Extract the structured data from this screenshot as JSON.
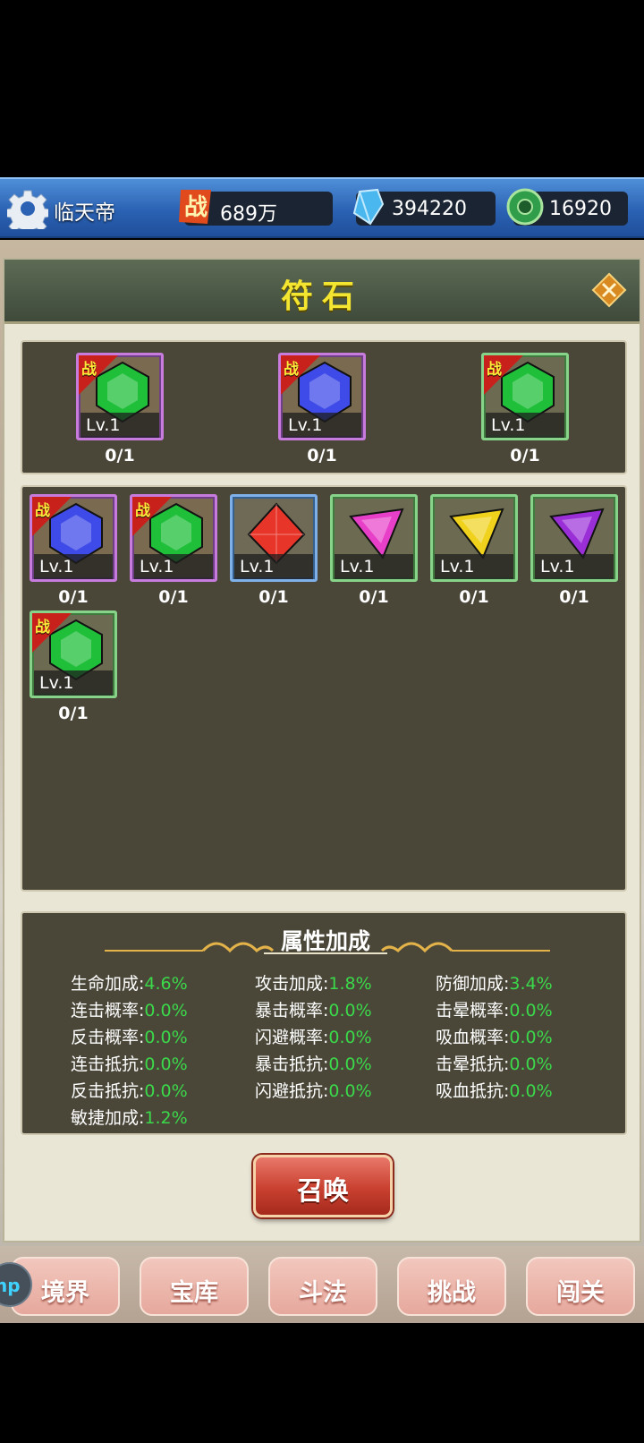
{
  "header": {
    "player_name": "临天帝",
    "power": "689万",
    "power_icon_text": "战",
    "crystals": "394220",
    "jade": "16920"
  },
  "panel": {
    "title": "符石"
  },
  "equipped": [
    {
      "level": "Lv.1",
      "count": "0/1",
      "tag": "战",
      "color": "green",
      "rarity": "purple"
    },
    {
      "level": "Lv.1",
      "count": "0/1",
      "tag": "战",
      "color": "blue",
      "rarity": "purple"
    },
    {
      "level": "Lv.1",
      "count": "0/1",
      "tag": "战",
      "color": "green",
      "rarity": "green"
    }
  ],
  "inventory": [
    {
      "level": "Lv.1",
      "count": "0/1",
      "tag": "战",
      "color": "blue",
      "rarity": "purple"
    },
    {
      "level": "Lv.1",
      "count": "0/1",
      "tag": "战",
      "color": "green",
      "rarity": "purple"
    },
    {
      "level": "Lv.1",
      "count": "0/1",
      "tag": "",
      "color": "red",
      "rarity": "blue"
    },
    {
      "level": "Lv.1",
      "count": "0/1",
      "tag": "",
      "color": "pink",
      "rarity": "green"
    },
    {
      "level": "Lv.1",
      "count": "0/1",
      "tag": "",
      "color": "yellow",
      "rarity": "green"
    },
    {
      "level": "Lv.1",
      "count": "0/1",
      "tag": "",
      "color": "purple",
      "rarity": "green"
    },
    {
      "level": "Lv.1",
      "count": "0/1",
      "tag": "战",
      "color": "green",
      "rarity": "green"
    }
  ],
  "attributes": {
    "title": "属性加成",
    "rows": [
      [
        {
          "label": "生命加成:",
          "value": "4.6%"
        },
        {
          "label": "攻击加成:",
          "value": "1.8%"
        },
        {
          "label": "防御加成:",
          "value": "3.4%"
        }
      ],
      [
        {
          "label": "连击概率:",
          "value": "0.0%"
        },
        {
          "label": "暴击概率:",
          "value": "0.0%"
        },
        {
          "label": "击晕概率:",
          "value": "0.0%"
        }
      ],
      [
        {
          "label": "反击概率:",
          "value": "0.0%"
        },
        {
          "label": "闪避概率:",
          "value": "0.0%"
        },
        {
          "label": "吸血概率:",
          "value": "0.0%"
        }
      ],
      [
        {
          "label": "连击抵抗:",
          "value": "0.0%"
        },
        {
          "label": "暴击抵抗:",
          "value": "0.0%"
        },
        {
          "label": "击晕抵抗:",
          "value": "0.0%"
        }
      ],
      [
        {
          "label": "反击抵抗:",
          "value": "0.0%"
        },
        {
          "label": "闪避抵抗:",
          "value": "0.0%"
        },
        {
          "label": "吸血抵抗:",
          "value": "0.0%"
        }
      ],
      [
        {
          "label": "敏捷加成:",
          "value": "1.2%"
        }
      ]
    ]
  },
  "summon_label": "召唤",
  "nav": {
    "hp_label": "hp",
    "items": [
      "境界",
      "宝库",
      "斗法",
      "挑战",
      "闯关"
    ]
  },
  "colors": {
    "title_yellow": "#f4e630",
    "value_green": "#3bd84a",
    "gem_green": "#1fbf3a",
    "gem_blue": "#3f4be8",
    "gem_red": "#e8352a",
    "gem_pink": "#e83fc8",
    "gem_yellow": "#f0d21c",
    "gem_purple": "#9a2fd8"
  }
}
